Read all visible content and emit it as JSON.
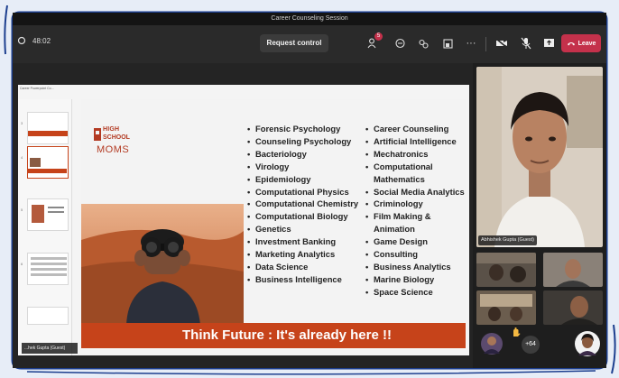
{
  "window": {
    "title": "Career Counseling Session"
  },
  "toolbar": {
    "timer": "48:02",
    "request_control_label": "Request control",
    "participants_badge": "5",
    "leave_label": "Leave"
  },
  "presentation": {
    "file_title": "Career Powerpoint Co..."
  },
  "slide": {
    "logo_high": "HIGH",
    "logo_school": "SCHOOL",
    "logo_moms": "MOMS",
    "left_column": [
      "Forensic Psychology",
      "Counseling Psychology",
      "Bacteriology",
      "Virology",
      "Epidemiology",
      "Computational Physics",
      "Computational Chemistry",
      "Computational Biology",
      "Genetics",
      "Investment Banking",
      "Marketing Analytics",
      "Data Science",
      "Business Intelligence"
    ],
    "right_column": [
      "Career Counseling",
      "Artificial Intelligence",
      "Mechatronics",
      "Computational Mathematics",
      "Social Media Analytics",
      "Criminology",
      "Film Making & Animation",
      "Game Design",
      "Consulting",
      "Business Analytics",
      "Marine Biology",
      "Space Science"
    ],
    "banner": "Think Future : It's already here !!"
  },
  "presenter": {
    "name": "...hek Gupta (Guest)"
  },
  "speaker": {
    "name": "Abhishek Gupta (Guest)"
  },
  "participants": {
    "more_count": "+64"
  },
  "colors": {
    "accent": "#c6431a",
    "leave": "#c4314b",
    "frame": "#1d3f8f"
  }
}
